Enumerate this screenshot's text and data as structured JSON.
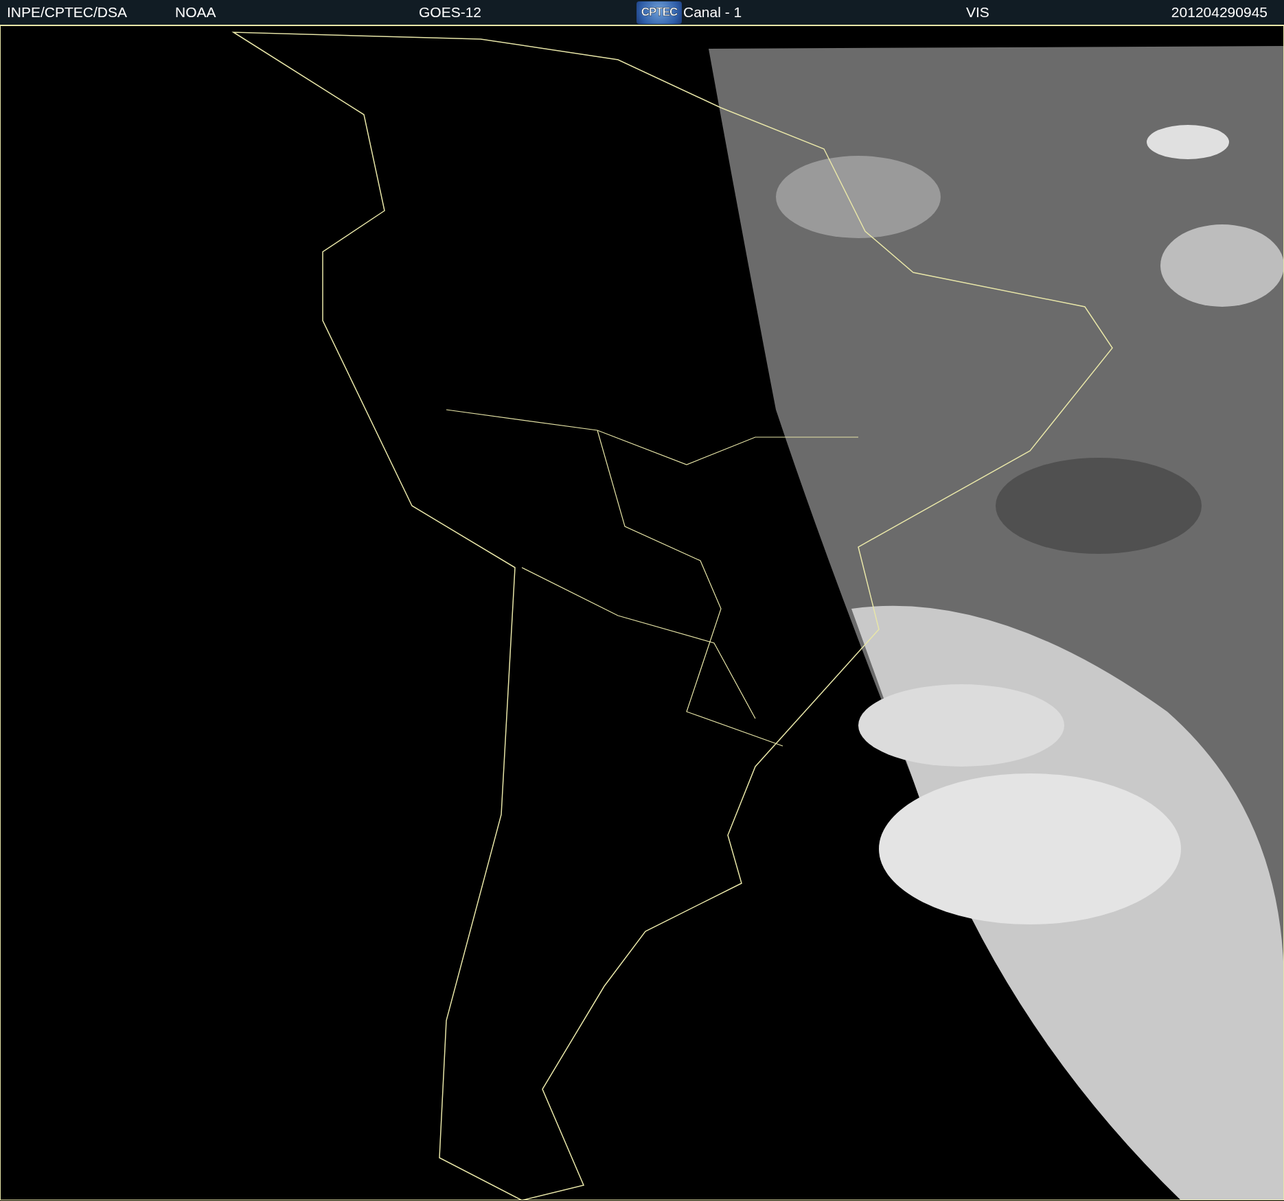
{
  "header": {
    "source": "INPE/CPTEC/DSA",
    "agency": "NOAA",
    "satellite": "GOES-12",
    "logo": "CPTEC",
    "channel": "Canal - 1",
    "band": "VIS",
    "timestamp": "201204290945"
  }
}
